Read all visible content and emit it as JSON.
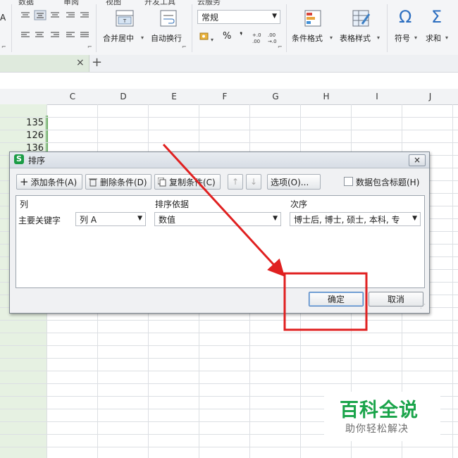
{
  "ribbon": {
    "tabs": [
      "数据",
      "审阅",
      "视图",
      "开发工具",
      "云服务"
    ],
    "font_a": "A",
    "merge_center": "合并居中",
    "auto_wrap": "自动换行",
    "number_format": "常规",
    "percent": "%",
    "comma": "❜",
    "cond_format": "条件格式",
    "table_style": "表格样式",
    "symbol": "符号",
    "sum": "求和",
    "omega": "Ω",
    "sigma": "Σ"
  },
  "docbar": {
    "close": "×",
    "add": "+"
  },
  "sheet": {
    "columns": [
      "C",
      "D",
      "E",
      "F",
      "G",
      "H",
      "I",
      "J"
    ],
    "values": [
      "135",
      "126",
      "136"
    ]
  },
  "dialog": {
    "logo": "S",
    "title": "排序",
    "close": "×",
    "add_condition": "添加条件(A)",
    "delete_condition": "删除条件(D)",
    "copy_condition": "复制条件(C)",
    "up": "↑",
    "down": "↓",
    "options": "选项(O)...",
    "has_header": "数据包含标题(H)",
    "col_header": "列",
    "basis_header": "排序依据",
    "order_header": "次序",
    "row_label": "主要关键字",
    "key_value": "列 A",
    "basis_value": "数值",
    "order_value": "博士后, 博士, 硕士, 本科, 专",
    "ok": "确定",
    "cancel": "取消"
  },
  "watermark": {
    "title": "百科全说",
    "subtitle": "助你轻松解决"
  },
  "colors": {
    "accent_green": "#1aa44a",
    "highlight_red": "#e02020",
    "selection_green": "#4aa13e"
  }
}
